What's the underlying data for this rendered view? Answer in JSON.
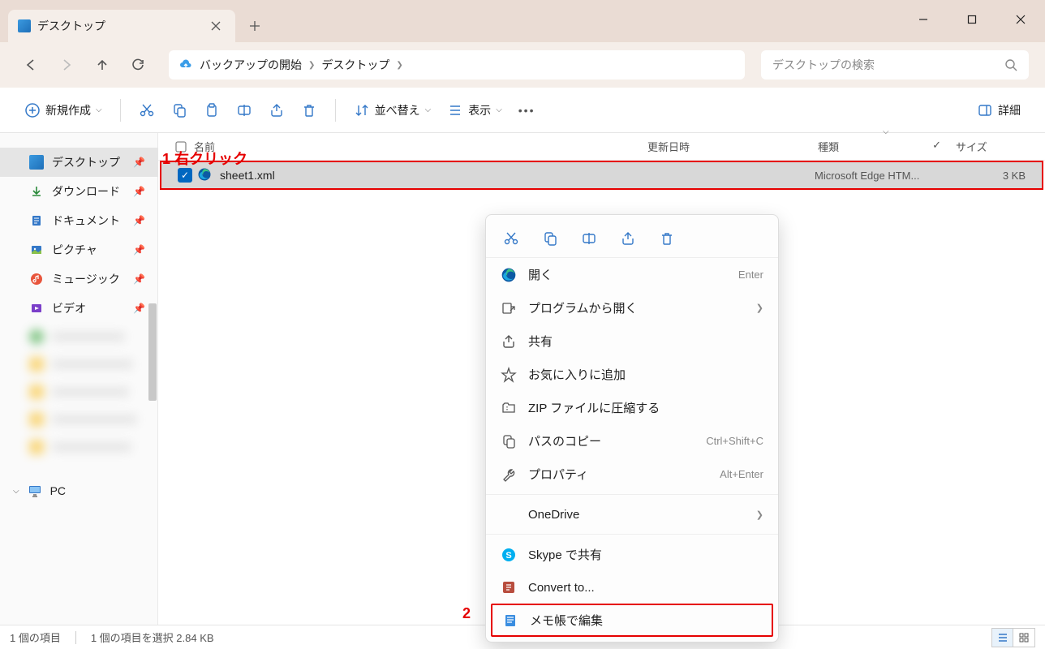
{
  "window": {
    "tab_title": "デスクトップ"
  },
  "breadcrumb": {
    "seg1": "バックアップの開始",
    "seg2": "デスクトップ"
  },
  "search": {
    "placeholder": "デスクトップの検索"
  },
  "toolbar": {
    "new": "新規作成",
    "sort": "並べ替え",
    "view": "表示",
    "details": "詳細"
  },
  "sidebar": {
    "items": [
      {
        "label": "デスクトップ",
        "icon": "desktop",
        "active": true
      },
      {
        "label": "ダウンロード",
        "icon": "download"
      },
      {
        "label": "ドキュメント",
        "icon": "document"
      },
      {
        "label": "ピクチャ",
        "icon": "pictures"
      },
      {
        "label": "ミュージック",
        "icon": "music"
      },
      {
        "label": "ビデオ",
        "icon": "video"
      }
    ],
    "pc": "PC"
  },
  "columns": {
    "name": "名前",
    "date": "更新日時",
    "type": "種類",
    "size": "サイズ"
  },
  "file": {
    "name": "sheet1.xml",
    "type": "Microsoft Edge HTM...",
    "size": "3 KB"
  },
  "annotations": {
    "one": "1 右クリック",
    "two": "2"
  },
  "context_menu": {
    "open": "開く",
    "open_shortcut": "Enter",
    "open_with": "プログラムから開く",
    "share": "共有",
    "favorites": "お気に入りに追加",
    "compress": "ZIP ファイルに圧縮する",
    "copy_path": "パスのコピー",
    "copy_path_shortcut": "Ctrl+Shift+C",
    "properties": "プロパティ",
    "properties_shortcut": "Alt+Enter",
    "onedrive": "OneDrive",
    "skype": "Skype で共有",
    "convert": "Convert to...",
    "notepad": "メモ帳で編集"
  },
  "statusbar": {
    "count": "1 個の項目",
    "selected": "1 個の項目を選択 2.84 KB"
  }
}
